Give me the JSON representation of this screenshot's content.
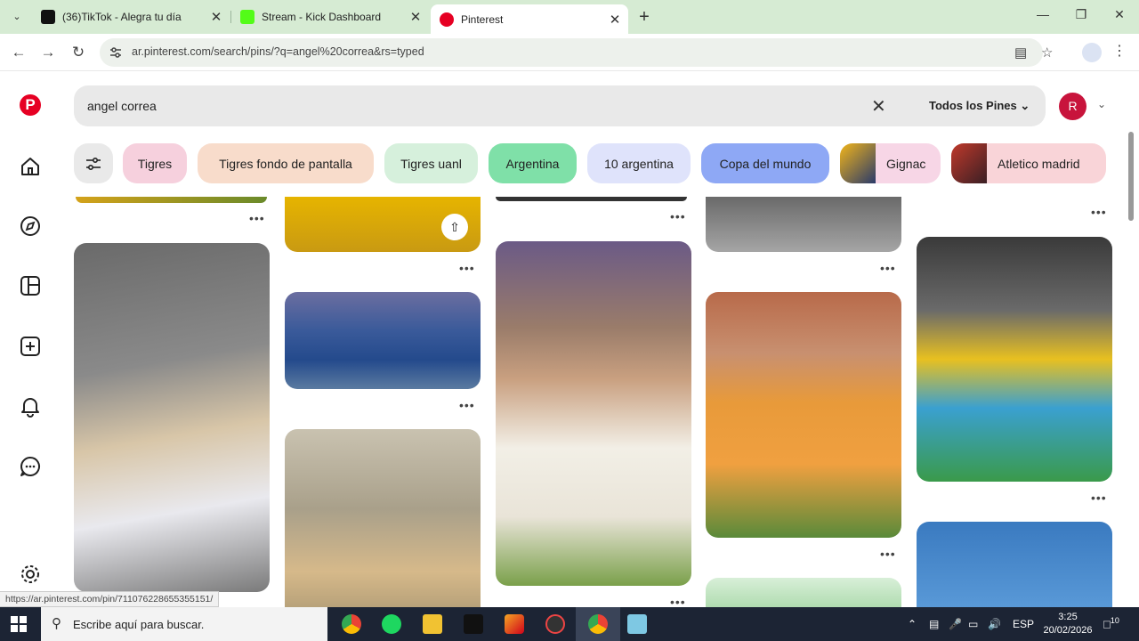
{
  "browser": {
    "tabs": [
      {
        "title": "(36)TikTok - Alegra tu día",
        "favicon_color": "#111111",
        "active": false
      },
      {
        "title": "Stream - Kick Dashboard",
        "favicon_color": "#53fc18",
        "active": false
      },
      {
        "title": "Pinterest",
        "favicon_color": "#e60023",
        "active": true
      }
    ],
    "url": "ar.pinterest.com/search/pins/?q=angel%20correa&rs=typed"
  },
  "search": {
    "query": "angel correa",
    "filter_label": "Todos los Pines"
  },
  "profile": {
    "initial": "R",
    "color": "#c8143c"
  },
  "chips": [
    {
      "label": "Tigres",
      "color": "#f6d0dd"
    },
    {
      "label": "Tigres fondo de pantalla",
      "color": "#f8dccb"
    },
    {
      "label": "Tigres uanl",
      "color": "#d6f0dc"
    },
    {
      "label": "Argentina",
      "color": "#7fe0a8"
    },
    {
      "label": "10 argentina",
      "color": "#dfe3fb"
    },
    {
      "label": "Copa del mundo",
      "color": "#8ea8f5"
    },
    {
      "label": "Gignac",
      "color": "#f7d6e6"
    },
    {
      "label": "Atletico madrid",
      "color": "#f9d4d8"
    }
  ],
  "status_url": "https://ar.pinterest.com/pin/711076228655355151/",
  "taskbar": {
    "search_placeholder": "Escribe aquí para buscar.",
    "language": "ESP",
    "time": "3:25",
    "date": "20/02/2026",
    "notifications": "10"
  },
  "icons": {
    "home": "home-icon",
    "explore": "compass-icon",
    "boards": "dashboard-icon",
    "create": "plus-icon",
    "notifications": "bell-icon",
    "messages": "chat-icon",
    "settings": "gear-icon"
  }
}
